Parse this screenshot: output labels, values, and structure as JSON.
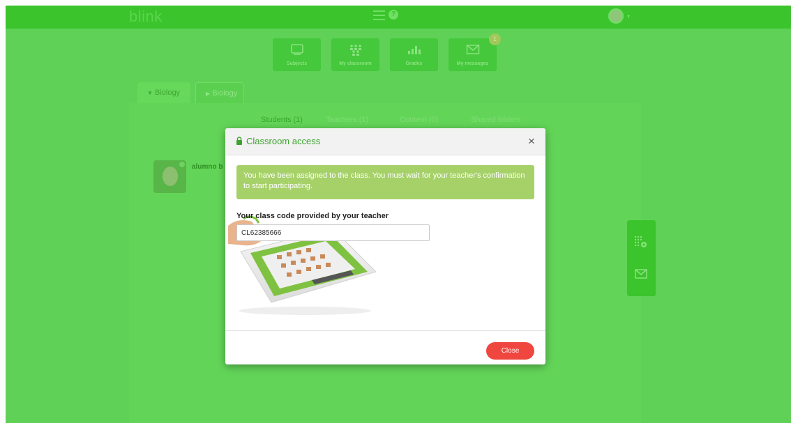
{
  "app": {
    "logo": "blink"
  },
  "colors": {
    "brand_green": "#3bc42c",
    "overlay_green": "#5fd157",
    "alert_green": "#a6d169",
    "close_red": "#f04640"
  },
  "topbar": {
    "menu_icon": "hamburger-icon",
    "help_icon": "help-icon",
    "help_glyph": "?",
    "avatar_caret": "▾"
  },
  "nav": {
    "items": [
      {
        "label": "Subjects",
        "icon": "tablet-icon"
      },
      {
        "label": "My classroom",
        "icon": "classroom-icon"
      },
      {
        "label": "Grades",
        "icon": "bar-chart-icon"
      },
      {
        "label": "My messages",
        "icon": "envelope-icon"
      }
    ],
    "messages_badge": "1"
  },
  "subject_tabs": [
    {
      "label": "Biology",
      "arrow": "▼"
    },
    {
      "label": "Biology",
      "arrow": "▶"
    }
  ],
  "classroom_tabs": {
    "students": "Students (1)",
    "teachers": "Teachers (1)",
    "content": "Content (0)",
    "shared": "Shared folders"
  },
  "student": {
    "name": "alumno b"
  },
  "side_actions": {
    "icons": [
      "add-code-icon",
      "envelope-icon"
    ]
  },
  "modal": {
    "title": "Classroom access",
    "close_glyph": "×",
    "alert_text": "You have been assigned to the class. You must wait for your teacher's confirmation to start participating.",
    "field_label": "Your class code provided by your teacher",
    "field_value": "CL62385666",
    "close_button": "Close"
  }
}
